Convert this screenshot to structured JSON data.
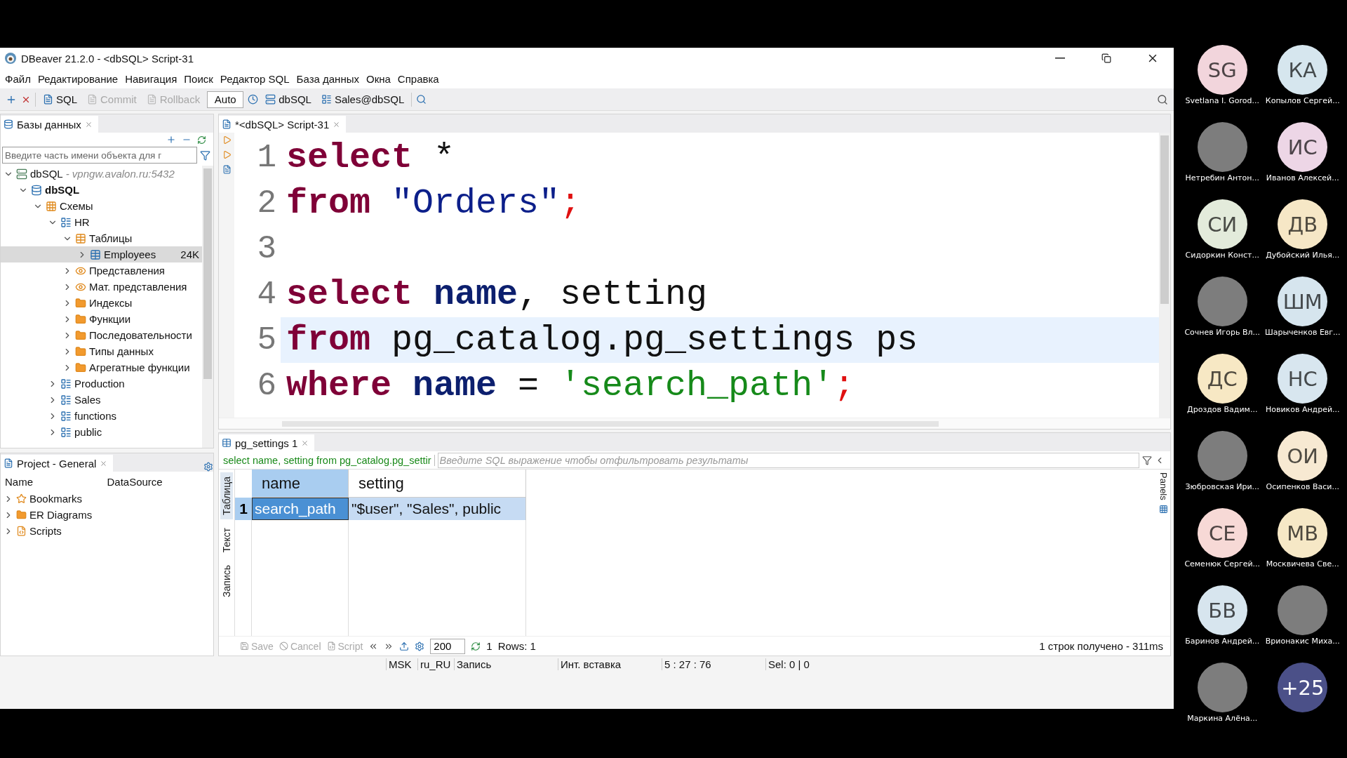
{
  "window": {
    "title": "DBeaver 21.2.0 - <dbSQL> Script-31"
  },
  "menu": [
    "Файл",
    "Редактирование",
    "Навигация",
    "Поиск",
    "Редактор SQL",
    "База данных",
    "Окна",
    "Справка"
  ],
  "toolbar": [
    {
      "kind": "sql",
      "label": "SQL",
      "disabled": false
    },
    {
      "kind": "commit",
      "label": "Commit",
      "disabled": true
    },
    {
      "kind": "rollback",
      "label": "Rollback",
      "disabled": true
    },
    {
      "kind": "mode",
      "label": "Auto",
      "disabled": false
    },
    {
      "kind": "connection",
      "label": "dbSQL",
      "disabled": false
    },
    {
      "kind": "schema",
      "label": "Sales@dbSQL",
      "disabled": false
    }
  ],
  "navigator": {
    "tab": "Базы данных",
    "filter_placeholder": "Введите часть имени объекта для г",
    "tree": [
      {
        "kind": "connection",
        "label": "dbSQL",
        "subtitle": "- vpngw.avalon.ru:5432",
        "expanded": true,
        "selected": false,
        "children": [
          {
            "kind": "database",
            "label": "dbSQL",
            "expanded": true,
            "selected": false,
            "children": [
              {
                "kind": "schemas",
                "label": "Схемы",
                "expanded": true,
                "selected": false,
                "children": [
                  {
                    "kind": "schema",
                    "label": "HR",
                    "expanded": true,
                    "selected": false,
                    "children": [
                      {
                        "kind": "tables",
                        "label": "Таблицы",
                        "expanded": true,
                        "selected": false,
                        "children": [
                          {
                            "kind": "table",
                            "label": "Employees",
                            "badge": "24K",
                            "expanded": false,
                            "selected": true
                          }
                        ]
                      },
                      {
                        "kind": "views",
                        "label": "Представления",
                        "expanded": false,
                        "selected": false
                      },
                      {
                        "kind": "views",
                        "label": "Мат. представления",
                        "expanded": false,
                        "selected": false
                      },
                      {
                        "kind": "folder",
                        "label": "Индексы",
                        "expanded": false,
                        "selected": false
                      },
                      {
                        "kind": "folder",
                        "label": "Функции",
                        "expanded": false,
                        "selected": false
                      },
                      {
                        "kind": "folder",
                        "label": "Последовательности",
                        "expanded": false,
                        "selected": false
                      },
                      {
                        "kind": "folder",
                        "label": "Типы данных",
                        "expanded": false,
                        "selected": false
                      },
                      {
                        "kind": "folder",
                        "label": "Агрегатные функции",
                        "expanded": false,
                        "selected": false
                      }
                    ]
                  },
                  {
                    "kind": "schema",
                    "label": "Production",
                    "expanded": false,
                    "selected": false
                  },
                  {
                    "kind": "schema",
                    "label": "Sales",
                    "expanded": false,
                    "selected": false
                  },
                  {
                    "kind": "schema",
                    "label": "functions",
                    "expanded": false,
                    "selected": false
                  },
                  {
                    "kind": "schema",
                    "label": "public",
                    "expanded": false,
                    "selected": false
                  }
                ]
              }
            ]
          }
        ]
      }
    ]
  },
  "project": {
    "tab": "Project - General",
    "columns": [
      "Name",
      "DataSource"
    ],
    "items": [
      {
        "kind": "bookmarks",
        "label": "Bookmarks",
        "expanded": false
      },
      {
        "kind": "diagrams",
        "label": "ER Diagrams",
        "expanded": false
      },
      {
        "kind": "scripts",
        "label": "Scripts",
        "expanded": false
      }
    ]
  },
  "editor": {
    "tab": "*<dbSQL> Script-31",
    "lines": [
      {
        "number": "1",
        "current": false,
        "tokens": [
          {
            "kind": "keyword",
            "text": "select"
          },
          {
            "kind": "plain",
            "text": " *"
          }
        ]
      },
      {
        "number": "2",
        "current": false,
        "tokens": [
          {
            "kind": "keyword",
            "text": "from"
          },
          {
            "kind": "quoted",
            "text": " \"Orders\""
          },
          {
            "kind": "punct",
            "text": ";"
          }
        ]
      },
      {
        "number": "3",
        "current": false
      },
      {
        "number": "4",
        "current": false,
        "tokens": [
          {
            "kind": "keyword",
            "text": "select"
          },
          {
            "kind": "name",
            "text": " name"
          },
          {
            "kind": "plain",
            "text": ", setting"
          }
        ]
      },
      {
        "number": "5",
        "current": true,
        "tokens": [
          {
            "kind": "keyword",
            "text": "from"
          },
          {
            "kind": "plain",
            "text": " pg_catalog.pg_settings ps"
          }
        ]
      },
      {
        "number": "6",
        "current": false,
        "tokens": [
          {
            "kind": "keyword",
            "text": "where"
          },
          {
            "kind": "name",
            "text": " name"
          },
          {
            "kind": "plain",
            "text": " = "
          },
          {
            "kind": "string",
            "text": "'search_path'"
          },
          {
            "kind": "punct",
            "text": ";"
          }
        ]
      }
    ]
  },
  "results": {
    "tab": "pg_settings 1",
    "query": "select name, setting from pg_catalog.pg_settir",
    "filter_placeholder": "Введите SQL выражение чтобы отфильтровать результаты",
    "side_tabs": [
      {
        "label": "Таблица",
        "selected": true
      },
      {
        "label": "Текст",
        "selected": false
      },
      {
        "label": "Запись",
        "selected": false
      }
    ],
    "panels_label": "Panels",
    "columns": [
      {
        "label": "name",
        "selected": true
      },
      {
        "label": "setting",
        "selected": false
      }
    ],
    "rows": [
      {
        "number": "1",
        "selected": true,
        "cells": [
          {
            "text": "search_path",
            "focused": true
          },
          {
            "text": "\"$user\", \"Sales\", public",
            "focused": false
          }
        ]
      }
    ],
    "actions": [
      {
        "label": "Save",
        "disabled": true
      },
      {
        "label": "Cancel",
        "disabled": true
      },
      {
        "label": "Script",
        "disabled": true
      }
    ],
    "fetch_size": "200",
    "refresh_count": "1",
    "rows_label": "Rows: 1",
    "fetch_status": "1 строк получено - 311ms"
  },
  "status_bar": [
    "MSK",
    "ru_RU",
    "Запись",
    "Инт. вставка",
    "5 : 27 : 76",
    "Sel: 0 | 0"
  ],
  "participant_rows": [
    {
      "people": [
        {
          "kind": "initials",
          "initials": "SG",
          "name": "Svetlana I. Gorod...",
          "color": "#f2d5dc"
        },
        {
          "kind": "initials",
          "initials": "КА",
          "name": "Копылов Сергей...",
          "color": "#d6e6ee"
        }
      ]
    },
    {
      "people": [
        {
          "kind": "photo",
          "name": "Нетребин Антон..."
        },
        {
          "kind": "initials",
          "initials": "ИС",
          "name": "Иванов Алексей...",
          "color": "#edd6e6"
        }
      ]
    },
    {
      "people": [
        {
          "kind": "initials",
          "initials": "СИ",
          "name": "Сидоркин Конст...",
          "color": "#e3ebdb"
        },
        {
          "kind": "initials",
          "initials": "ДВ",
          "name": "Дубойский Илья...",
          "color": "#f6e7c6"
        }
      ]
    },
    {
      "people": [
        {
          "kind": "photo",
          "name": "Сочнев Игорь Вл..."
        },
        {
          "kind": "initials",
          "initials": "ШМ",
          "name": "Шарыченков Евг...",
          "color": "#d6e5ee"
        }
      ]
    },
    {
      "people": [
        {
          "kind": "initials",
          "initials": "ДС",
          "name": "Дроздов Вадим...",
          "color": "#f7e8c4"
        },
        {
          "kind": "initials",
          "initials": "НС",
          "name": "Новиков Андрей...",
          "color": "#d8e6ef"
        }
      ]
    },
    {
      "people": [
        {
          "kind": "photo",
          "name": "Зюбровская Ири..."
        },
        {
          "kind": "initials",
          "initials": "ОИ",
          "name": "Осипенков Васи...",
          "color": "#f7e9d2"
        }
      ]
    },
    {
      "people": [
        {
          "kind": "initials",
          "initials": "СЕ",
          "name": "Семенюк Сергей...",
          "color": "#f7d9d6"
        },
        {
          "kind": "initials",
          "initials": "МВ",
          "name": "Москвичева Све...",
          "color": "#f6e8c6"
        }
      ]
    },
    {
      "people": [
        {
          "kind": "initials",
          "initials": "БВ",
          "name": "Баринов Андрей...",
          "color": "#d7e5ee"
        },
        {
          "kind": "photo",
          "name": "Врионакис Миха..."
        }
      ]
    },
    {
      "people": [
        {
          "kind": "photo",
          "name": "Маркина Алёна..."
        },
        {
          "kind": "more",
          "initials": "+25",
          "color": "#4b5088"
        }
      ]
    }
  ]
}
